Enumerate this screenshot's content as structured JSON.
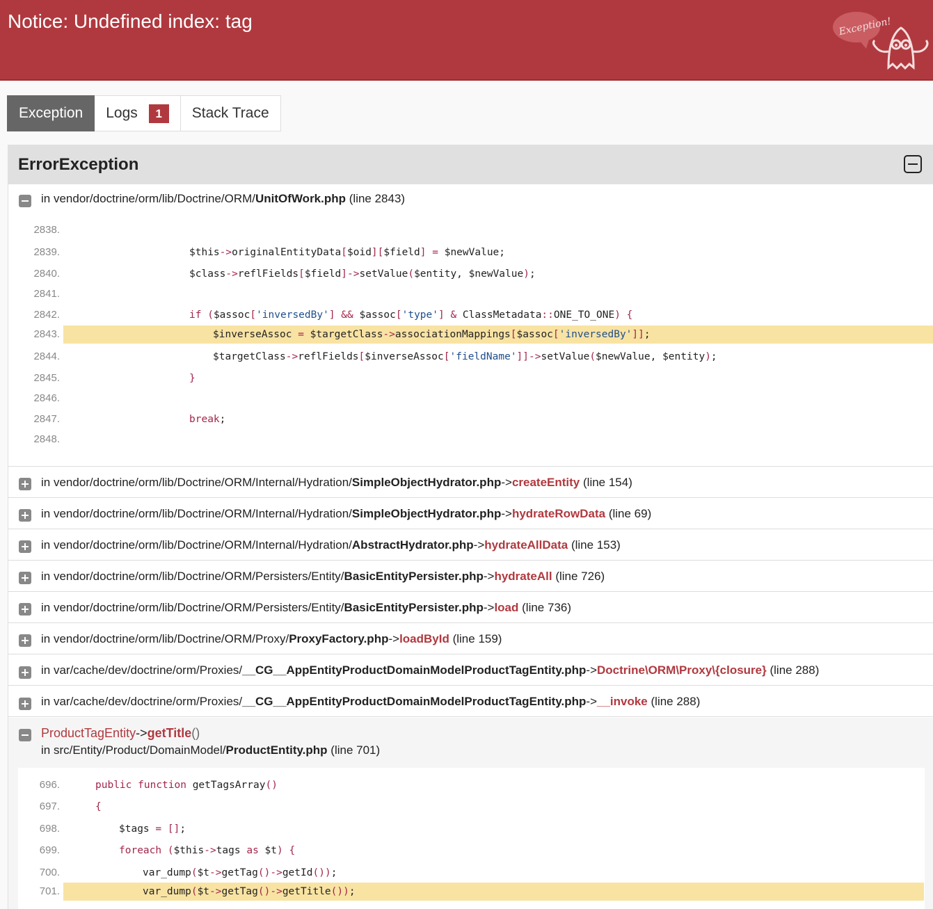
{
  "header": {
    "title": "Notice: Undefined index: tag",
    "logo_text": "Exception!"
  },
  "tabs": [
    {
      "label": "Exception",
      "active": true
    },
    {
      "label": "Logs",
      "badge": "1"
    },
    {
      "label": "Stack Trace"
    }
  ],
  "panel": {
    "title": "ErrorException",
    "frames": [
      {
        "prefix": "in vendor/doctrine/orm/lib/Doctrine/ORM/",
        "file": "UnitOfWork.php",
        "suffix": "(line 2843)"
      },
      {
        "prefix": "in vendor/doctrine/orm/lib/Doctrine/ORM/Internal/Hydration/",
        "file": "SimpleObjectHydrator.php",
        "arrow": "->",
        "fn": "createEntity",
        "suffix": "(line 154)"
      },
      {
        "prefix": "in vendor/doctrine/orm/lib/Doctrine/ORM/Internal/Hydration/",
        "file": "SimpleObjectHydrator.php",
        "arrow": "->",
        "fn": "hydrateRowData",
        "suffix": "(line 69)"
      },
      {
        "prefix": "in vendor/doctrine/orm/lib/Doctrine/ORM/Internal/Hydration/",
        "file": "AbstractHydrator.php",
        "arrow": "->",
        "fn": "hydrateAllData",
        "suffix": "(line 153)"
      },
      {
        "prefix": "in vendor/doctrine/orm/lib/Doctrine/ORM/Persisters/Entity/",
        "file": "BasicEntityPersister.php",
        "arrow": "->",
        "fn": "hydrateAll",
        "suffix": "(line 726)"
      },
      {
        "prefix": "in vendor/doctrine/orm/lib/Doctrine/ORM/Persisters/Entity/",
        "file": "BasicEntityPersister.php",
        "arrow": "->",
        "fn": "load",
        "suffix": "(line 736)"
      },
      {
        "prefix": "in vendor/doctrine/orm/lib/Doctrine/ORM/Proxy/",
        "file": "ProxyFactory.php",
        "arrow": "->",
        "fn": "loadById",
        "suffix": "(line 159)"
      },
      {
        "prefix": "in var/cache/dev/doctrine/orm/Proxies/",
        "file": "__CG__AppEntityProductDomainModelProductTagEntity.php",
        "arrow": "->",
        "fn": "Doctrine\\ORM\\Proxy\\{closure}",
        "suffix": "(line 288)"
      },
      {
        "prefix": "in var/cache/dev/doctrine/orm/Proxies/",
        "file": "__CG__AppEntityProductDomainModelProductTagEntity.php",
        "arrow": "->",
        "fn": "__invoke",
        "suffix": "(line 288)"
      },
      {
        "cls": "ProductTagEntity",
        "arrow": "->",
        "fn": "getTitle",
        "paren": "()",
        "prefix": "in src/Entity/Product/DomainModel/",
        "file": "ProductEntity.php",
        "suffix": "(line 701)"
      }
    ]
  },
  "code1": {
    "lines": [
      "2838.",
      "2839.",
      "2840.",
      "2841.",
      "2842.",
      "2843.",
      "2844.",
      "2845.",
      "2846.",
      "2847.",
      "2848."
    ],
    "highlight": "2843."
  },
  "code2": {
    "lines": [
      "696.",
      "697.",
      "698.",
      "699.",
      "700.",
      "701."
    ],
    "highlight": "701."
  },
  "colors": {
    "header": "#b0393f",
    "highlight": "#f8e3a3",
    "keyword": "#a3264a",
    "string": "#1f4e8c"
  }
}
